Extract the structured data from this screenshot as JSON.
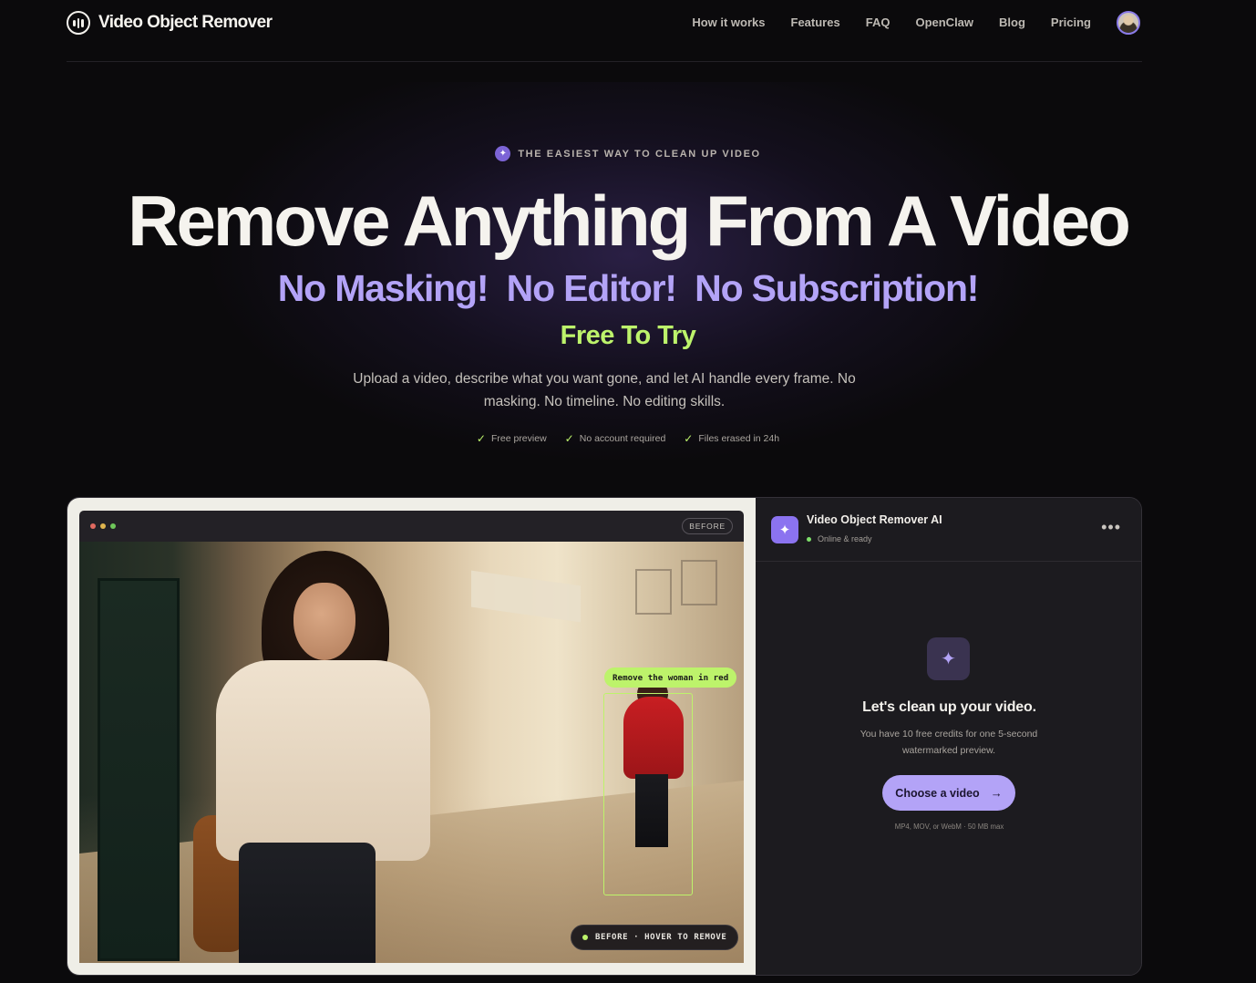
{
  "brand": {
    "name": "Video Object Remover"
  },
  "nav": {
    "links": [
      "How it works",
      "Features",
      "FAQ",
      "OpenClaw",
      "Blog",
      "Pricing"
    ]
  },
  "hero": {
    "eyebrow": "THE EASIEST WAY TO CLEAN UP VIDEO",
    "title": "Remove Anything From A Video",
    "subtitle": "No Masking!  No Editor!  No Subscription!",
    "tagline": "Free To Try",
    "lede": "Upload a video, describe what you want gone, and let AI handle every frame. No masking. No timeline. No editing skills.",
    "checks": [
      "Free preview",
      "No account required",
      "Files erased in 24h"
    ]
  },
  "demo": {
    "before_tag": "BEFORE",
    "prompt_chip": "Remove the woman in red",
    "status_pill": "BEFORE · HOVER TO REMOVE",
    "window_dots": [
      "#e06a60",
      "#e0b54e",
      "#6fc75a"
    ]
  },
  "assistant": {
    "name": "Video Object Remover AI",
    "status": "Online & ready",
    "empty_title": "Let's clean up your video.",
    "empty_sub": "You have 10 free credits for one 5-second watermarked preview.",
    "cta": "Choose a video",
    "fine_print": "MP4, MOV, or WebM · 50 MB max"
  },
  "colors": {
    "accent_purple": "#b3a3f7",
    "accent_green": "#bdf36b",
    "background": "#0b0a0c"
  }
}
